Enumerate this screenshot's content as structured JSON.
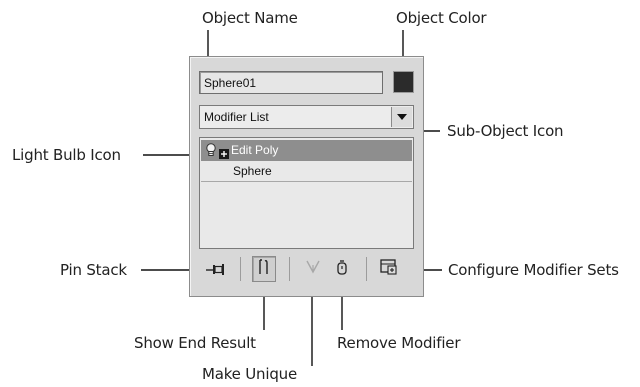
{
  "callouts": {
    "object_name": "Object Name",
    "object_color": "Object Color",
    "sub_object_icon": "Sub-Object Icon",
    "light_bulb_icon": "Light Bulb Icon",
    "pin_stack": "Pin Stack",
    "configure_modifier_sets": "Configure Modifier Sets",
    "show_end_result": "Show End Result",
    "remove_modifier": "Remove Modifier",
    "make_unique": "Make Unique"
  },
  "panel": {
    "object_name_value": "Sphere01",
    "object_color": "#2b2b2b",
    "modifier_list_label": "Modifier List",
    "stack": [
      {
        "label": "Edit Poly",
        "selected": true,
        "icons": [
          "light-bulb-icon",
          "expand-plus-icon"
        ]
      },
      {
        "label": "Sphere",
        "selected": false
      }
    ],
    "toolbar": [
      "pin-icon",
      "show-end-result-icon",
      "make-unique-icon",
      "remove-modifier-icon",
      "configure-modifier-sets-icon"
    ]
  },
  "colors": {
    "panel_bg": "#d8d8d8",
    "selected_row": "#8e8e8e"
  }
}
